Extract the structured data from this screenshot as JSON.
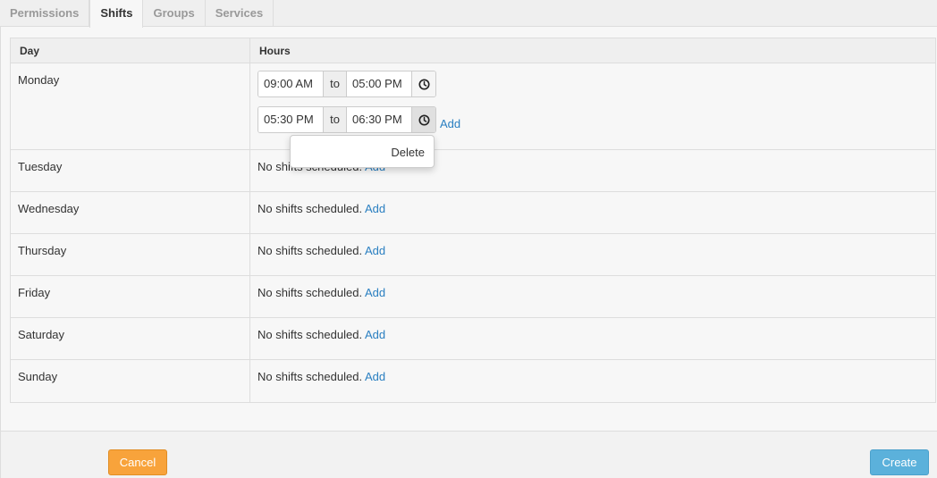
{
  "tabs": [
    {
      "label": "Permissions",
      "active": false
    },
    {
      "label": "Shifts",
      "active": true
    },
    {
      "label": "Groups",
      "active": false
    },
    {
      "label": "Services",
      "active": false
    }
  ],
  "table": {
    "headers": {
      "day": "Day",
      "hours": "Hours"
    },
    "monday": {
      "day": "Monday",
      "shifts": [
        {
          "start": "09:00 AM",
          "sep": "to",
          "end": "05:00 PM"
        },
        {
          "start": "05:30 PM",
          "sep": "to",
          "end": "06:30 PM"
        }
      ],
      "add_label": "Add"
    },
    "rows": [
      {
        "day": "Tuesday",
        "status": "No shifts scheduled.",
        "add_label": "Add"
      },
      {
        "day": "Wednesday",
        "status": "No shifts scheduled.",
        "add_label": "Add"
      },
      {
        "day": "Thursday",
        "status": "No shifts scheduled.",
        "add_label": "Add"
      },
      {
        "day": "Friday",
        "status": "No shifts scheduled.",
        "add_label": "Add"
      },
      {
        "day": "Saturday",
        "status": "No shifts scheduled.",
        "add_label": "Add"
      },
      {
        "day": "Sunday",
        "status": "No shifts scheduled.",
        "add_label": "Add"
      }
    ]
  },
  "popup": {
    "delete_label": "Delete"
  },
  "footer": {
    "cancel_label": "Cancel",
    "create_label": "Create"
  },
  "colors": {
    "link": "#2a7fc1",
    "cancel": "#f8a33b",
    "create": "#5bb1db"
  }
}
